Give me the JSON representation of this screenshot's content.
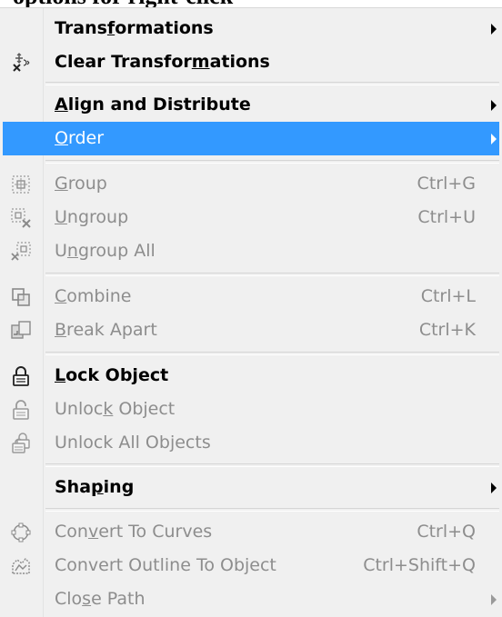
{
  "heading": "options for right-click",
  "menu": {
    "items": [
      {
        "pre": "Trans",
        "ul": "f",
        "post": "ormations",
        "shortcut": "",
        "icon": "none",
        "submenu": true
      },
      {
        "pre": "Clear Transfor",
        "ul": "m",
        "post": "ations",
        "shortcut": "",
        "icon": "clear-transformations-icon",
        "submenu": false
      },
      {
        "pre": "",
        "ul": "A",
        "post": "lign and Distribute",
        "shortcut": "",
        "icon": "none",
        "submenu": true
      },
      {
        "pre": "",
        "ul": "O",
        "post": "rder",
        "shortcut": "",
        "icon": "none",
        "submenu": true
      },
      {
        "pre": "",
        "ul": "G",
        "post": "roup",
        "shortcut": "Ctrl+G",
        "icon": "group-icon",
        "submenu": false
      },
      {
        "pre": "",
        "ul": "U",
        "post": "ngroup",
        "shortcut": "Ctrl+U",
        "icon": "ungroup-icon",
        "submenu": false
      },
      {
        "pre": "U",
        "ul": "n",
        "post": "group All",
        "shortcut": "",
        "icon": "ungroup-all-icon",
        "submenu": false
      },
      {
        "pre": "",
        "ul": "C",
        "post": "ombine",
        "shortcut": "Ctrl+L",
        "icon": "combine-icon",
        "submenu": false
      },
      {
        "pre": "",
        "ul": "B",
        "post": "reak  Apart",
        "shortcut": "Ctrl+K",
        "icon": "break-apart-icon",
        "submenu": false
      },
      {
        "pre": "",
        "ul": "L",
        "post": "ock Object",
        "shortcut": "",
        "icon": "lock-icon",
        "submenu": false
      },
      {
        "pre": "Unloc",
        "ul": "k",
        "post": " Object",
        "shortcut": "",
        "icon": "unlock-icon",
        "submenu": false
      },
      {
        "pre": "Unlock All Objects",
        "ul": "",
        "post": "",
        "shortcut": "",
        "icon": "unlock-all-icon",
        "submenu": false
      },
      {
        "pre": "Sha",
        "ul": "p",
        "post": "ing",
        "shortcut": "",
        "icon": "none",
        "submenu": true
      },
      {
        "pre": "Con",
        "ul": "v",
        "post": "ert To Curves",
        "shortcut": "Ctrl+Q",
        "icon": "convert-to-curves-icon",
        "submenu": false
      },
      {
        "pre": "Convert Outline To Ob",
        "ul": "j",
        "post": "ect",
        "shortcut": "Ctrl+Shift+Q",
        "icon": "convert-outline-icon",
        "submenu": false
      },
      {
        "pre": "Clo",
        "ul": "s",
        "post": "e Path",
        "shortcut": "",
        "icon": "none",
        "submenu": true
      }
    ]
  },
  "colors": {
    "menu_background": "#f0f0f0",
    "highlight": "#3399ff",
    "disabled_text": "#8d8d8d"
  }
}
